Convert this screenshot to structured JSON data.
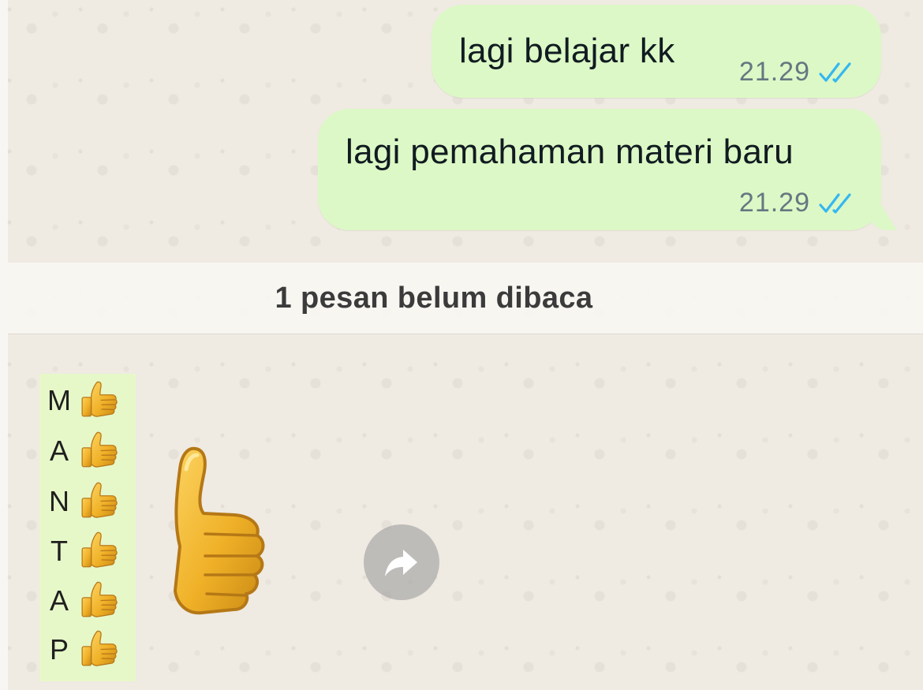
{
  "messages": [
    {
      "text": "lagi belajar kk",
      "time": "21.29",
      "status_icon": "double-check-read-icon"
    },
    {
      "text": "lagi pemahaman materi baru",
      "time": "21.29",
      "status_icon": "double-check-read-icon"
    }
  ],
  "unread_banner": {
    "text": "1 pesan belum dibaca"
  },
  "incoming": {
    "letters": [
      {
        "letter": "M"
      },
      {
        "letter": "A"
      },
      {
        "letter": "N"
      },
      {
        "letter": "T"
      },
      {
        "letter": "A"
      },
      {
        "letter": "P"
      }
    ],
    "emoji_icon": "thumbs-up-icon",
    "sticker_icon": "thumbs-up-sticker-icon"
  },
  "forward_icon": "forward-arrow-icon",
  "colors": {
    "outgoing_bubble": "#dcf8c6",
    "read_check": "#34b7f1",
    "chat_background": "#efeae2",
    "thumb_yellow": "#f3b928"
  }
}
